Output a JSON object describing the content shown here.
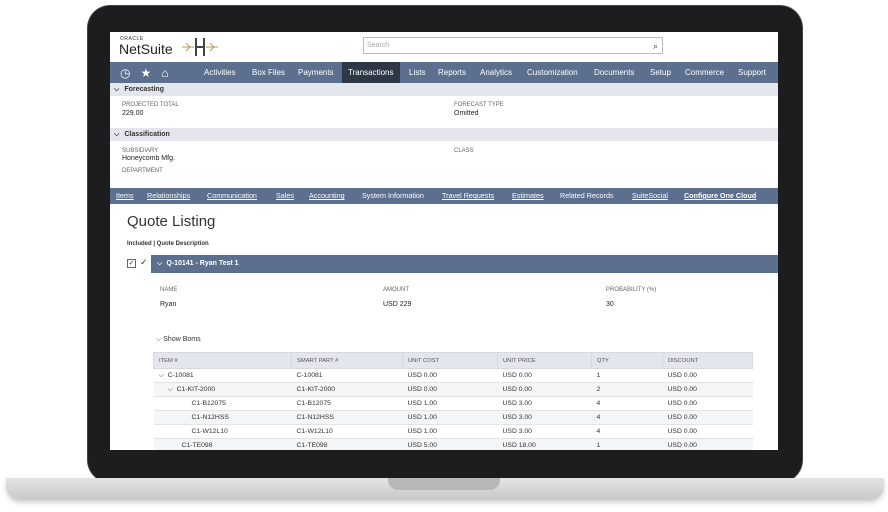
{
  "header": {
    "logo_small": "ORACLE",
    "logo_main": "NetSuite",
    "search_placeholder": "Search"
  },
  "nav": {
    "icons": [
      "recent-icon",
      "star-icon",
      "home-icon"
    ],
    "items": [
      "Activities",
      "Box Files",
      "Payments",
      "Transactions",
      "Lists",
      "Reports",
      "Analytics",
      "Customization",
      "Documents",
      "Setup",
      "Commerce",
      "Support"
    ],
    "active": "Transactions"
  },
  "forecasting": {
    "title": "Forecasting",
    "projected_total_label": "PROJECTED TOTAL",
    "projected_total_value": "229.00",
    "forecast_type_label": "FORECAST TYPE",
    "forecast_type_value": "Omitted"
  },
  "classification": {
    "title": "Classification",
    "subsidiary_label": "SUBSIDIARY",
    "subsidiary_value": "Honeycomb Mfg.",
    "department_label": "DEPARTMENT",
    "class_label": "CLASS"
  },
  "subtabs": [
    "Items",
    "Relationships",
    "Communication",
    "Sales",
    "Accounting",
    "System Information",
    "Travel Requests",
    "Estimates",
    "Related Records",
    "SuiteSocial",
    "Configure One Cloud"
  ],
  "quote_listing": {
    "title": "Quote Listing",
    "subtitle": "Included | Quote Description",
    "quote_header": "Q-10141 - Ryan Test 1",
    "name_label": "NAME",
    "name_value": "Ryan",
    "amount_label": "AMOUNT",
    "amount_value": "USD 229",
    "probability_label": "PROBABILITY (%)",
    "probability_value": "30",
    "show_boms": "Show Boms"
  },
  "boms_table": {
    "columns": [
      "ITEM #",
      "SMART PART #",
      "UNIT COST",
      "UNIT PRICE",
      "QTY",
      "DISCOUNT"
    ],
    "rows": [
      [
        "C-10081",
        "C-10081",
        "USD 0.00",
        "USD 0.00",
        "1",
        "USD 0.00"
      ],
      [
        "C1-KIT-2000",
        "C1-KIT-2000",
        "USD 0.00",
        "USD 0.00",
        "2",
        "USD 0.00"
      ],
      [
        "C1-B12075",
        "C1-B12075",
        "USD 1.00",
        "USD 3.00",
        "4",
        "USD 0.00"
      ],
      [
        "C1-N12HSS",
        "C1-N12HSS",
        "USD 1.00",
        "USD 3.00",
        "4",
        "USD 0.00"
      ],
      [
        "C1-W12L10",
        "C1-W12L10",
        "USD 1.00",
        "USD 3.00",
        "4",
        "USD 0.00"
      ],
      [
        "C1-TE098",
        "C1-TE098",
        "USD 5.00",
        "USD 18.00",
        "1",
        "USD 0.00"
      ]
    ]
  },
  "colors": {
    "nav_bg": "#5d6f8e",
    "nav_active": "#2e3746",
    "section_bg": "#e3e6ec"
  }
}
